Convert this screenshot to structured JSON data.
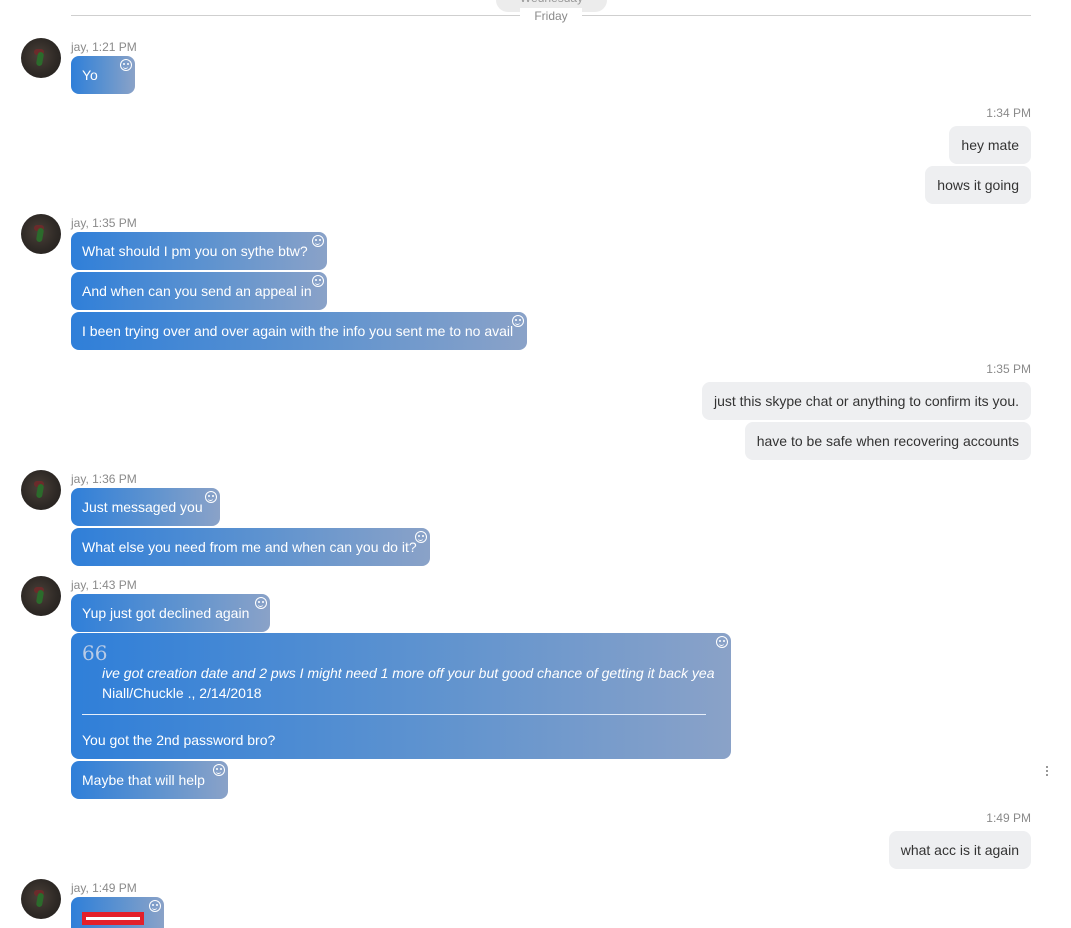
{
  "dates": {
    "previous": "Wednesday",
    "current": "Friday"
  },
  "groups": [
    {
      "meta": "jay, 1:21 PM"
    },
    {
      "meta": "1:34 PM"
    },
    {
      "meta": "jay, 1:35 PM"
    },
    {
      "meta": "1:35 PM"
    },
    {
      "meta": "jay, 1:36 PM"
    },
    {
      "meta": "jay, 1:43 PM"
    },
    {
      "meta": "1:49 PM"
    },
    {
      "meta": "jay, 1:49 PM"
    }
  ],
  "messages": {
    "m1": "Yo",
    "m2": "hey mate",
    "m3": "hows it going",
    "m4": "What should I pm you on sythe btw?",
    "m5": "And when can you send an appeal in",
    "m6": "I been trying over and over again with the info you sent me to no avail",
    "m7": "just this skype chat or anything to confirm its you.",
    "m8": "have to be safe when recovering accounts",
    "m9": "Just messaged you",
    "m10": "What else you need from me and when can you do it?",
    "m11": "Yup just got declined again",
    "m13": "Maybe that will help",
    "m14": "what acc is it again"
  },
  "quote": {
    "mark": "66",
    "text": "ive got creation date and 2 pws I might need 1 more off your but good chance of getting it back yea",
    "author": "Niall/Chuckle ., 2/14/2018",
    "reply": "You got the 2nd password bro?"
  },
  "icons": {
    "reaction": "smiley-icon",
    "more": "more-vertical-icon"
  },
  "colors": {
    "incoming_start": "#2f7fd9",
    "incoming_end": "#8aa2c8",
    "outgoing": "#eeeff1",
    "redaction": "#e3202a"
  }
}
